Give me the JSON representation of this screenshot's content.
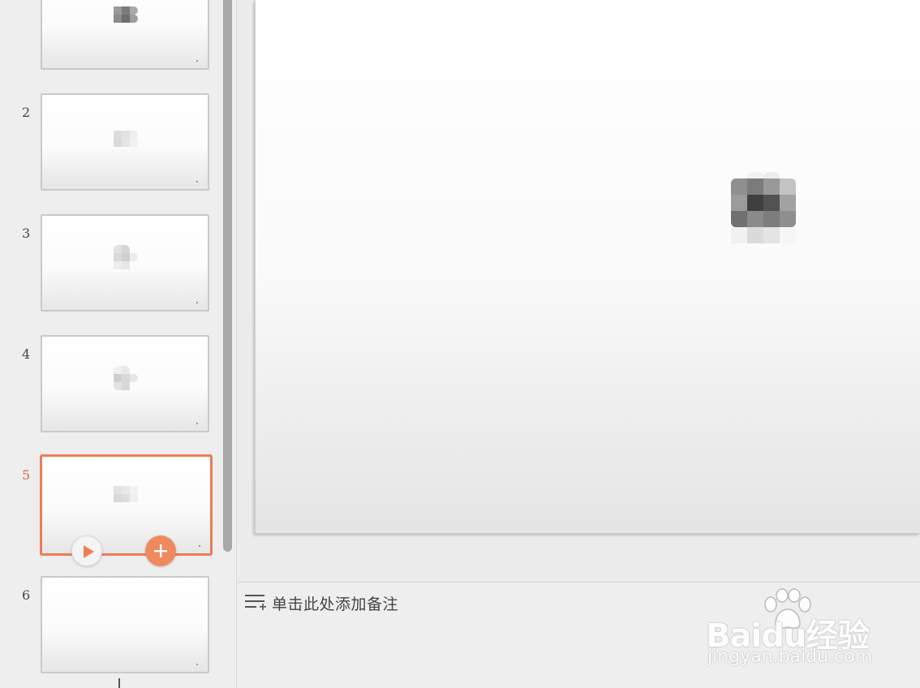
{
  "slide_panel": {
    "slides": [
      {
        "number": "",
        "active": false
      },
      {
        "number": "2",
        "active": false
      },
      {
        "number": "3",
        "active": false
      },
      {
        "number": "4",
        "active": false
      },
      {
        "number": "5",
        "active": true
      },
      {
        "number": "6",
        "active": false
      }
    ],
    "accent_color": "#ef7b57"
  },
  "notes": {
    "placeholder": "单击此处添加备注"
  },
  "watermark": {
    "brand": "Baidu经验",
    "url": "jingyan.baidu.com"
  }
}
